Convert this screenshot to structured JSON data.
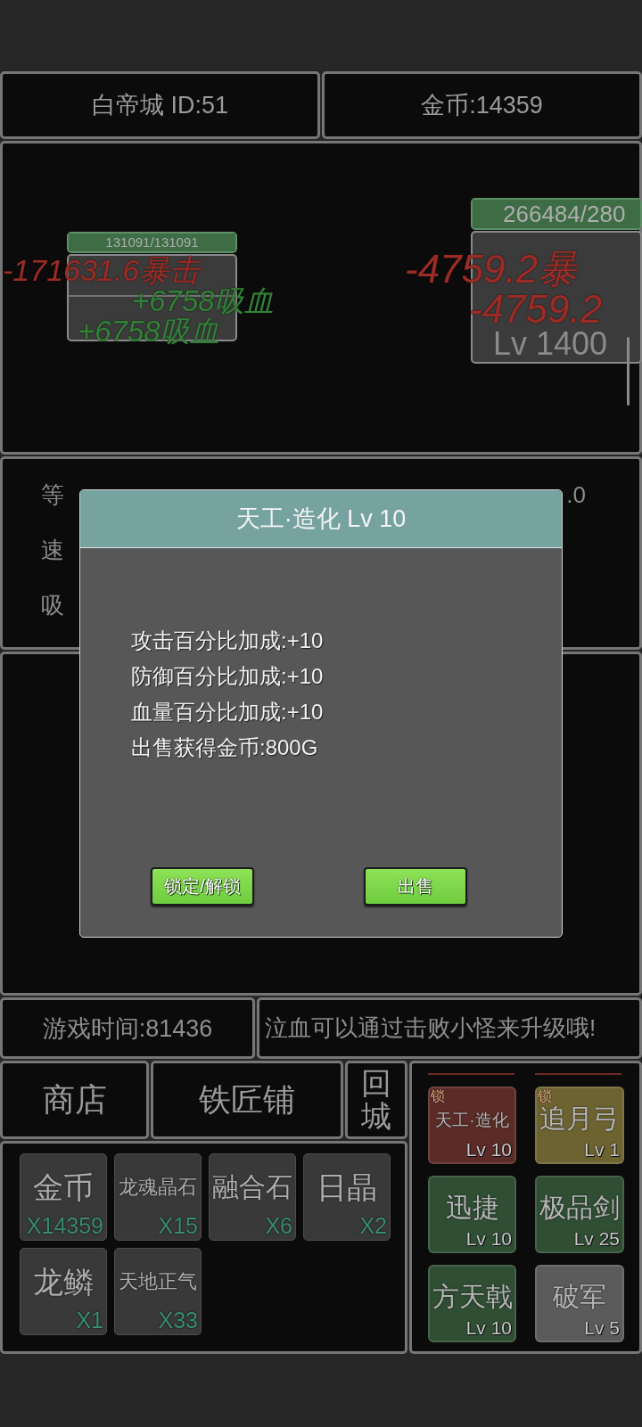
{
  "header": {
    "location": "白帝城 ID:51",
    "gold": "金币:14359"
  },
  "battle": {
    "player": {
      "hp_bar": {
        "text": "131091/131091",
        "level": 1
      }
    },
    "player_floating_texts": [
      {
        "text": "-171631.6暴击",
        "kind": "damage"
      },
      {
        "text": "+6758吸血",
        "kind": "heal"
      },
      {
        "text": "+6758吸血",
        "kind": "heal"
      }
    ],
    "enemy": {
      "hp_bar": {
        "text": "266484/280",
        "level": 1
      },
      "level_label": "Lv 1400"
    },
    "enemy_floating_texts": [
      {
        "text": "-4759.2暴",
        "kind": "damage"
      },
      {
        "text": "-4759.2",
        "kind": "damage"
      }
    ]
  },
  "stats": {
    "rows": [
      {
        "column_1": "等",
        "column_3": ".0"
      },
      {
        "column_1": "速"
      },
      {
        "column_1": "吸"
      }
    ]
  },
  "dialog": {
    "title": "天工·造化 Lv 10",
    "lines": [
      "攻击百分比加成:+10",
      "防御百分比加成:+10",
      "血量百分比加成:+10",
      "出售获得金币:800G"
    ],
    "buttons": [
      "锁定/解锁",
      "出售"
    ]
  },
  "info_bar": {
    "game_time": "游戏时间:81436",
    "tip": "泣血可以通过击败小怪来升级哦!"
  },
  "nav": [
    "商店",
    "铁匠铺",
    "回城"
  ],
  "inventory": {
    "items": [
      {
        "name": "金币",
        "count": "X14359"
      },
      {
        "name": "龙魂晶石",
        "count": "X15"
      },
      {
        "name": "融合石",
        "count": "X6"
      },
      {
        "name": "日晶",
        "count": "X2"
      },
      {
        "name": "龙鳞",
        "count": "X1"
      },
      {
        "name": "天地正气",
        "count": "X33"
      }
    ]
  },
  "equipment": {
    "items": [
      {
        "name": "天工·造化",
        "rank": "Lv 10",
        "color": "#5b2b27",
        "lock_label": "锁"
      },
      {
        "name": "追月弓",
        "rank": "Lv 1",
        "color": "#6d6331",
        "lock_label": "锁"
      },
      {
        "name": "迅捷",
        "rank": "Lv 10",
        "color": "#2f4e33"
      },
      {
        "name": "极品剑",
        "rank": "Lv 25",
        "color": "#2f4e33"
      },
      {
        "name": "方天戟",
        "rank": "Lv 10",
        "color": "#2f4e33"
      },
      {
        "name": "破军",
        "rank": "Lv 5",
        "color": "#5b5b5b"
      }
    ]
  }
}
